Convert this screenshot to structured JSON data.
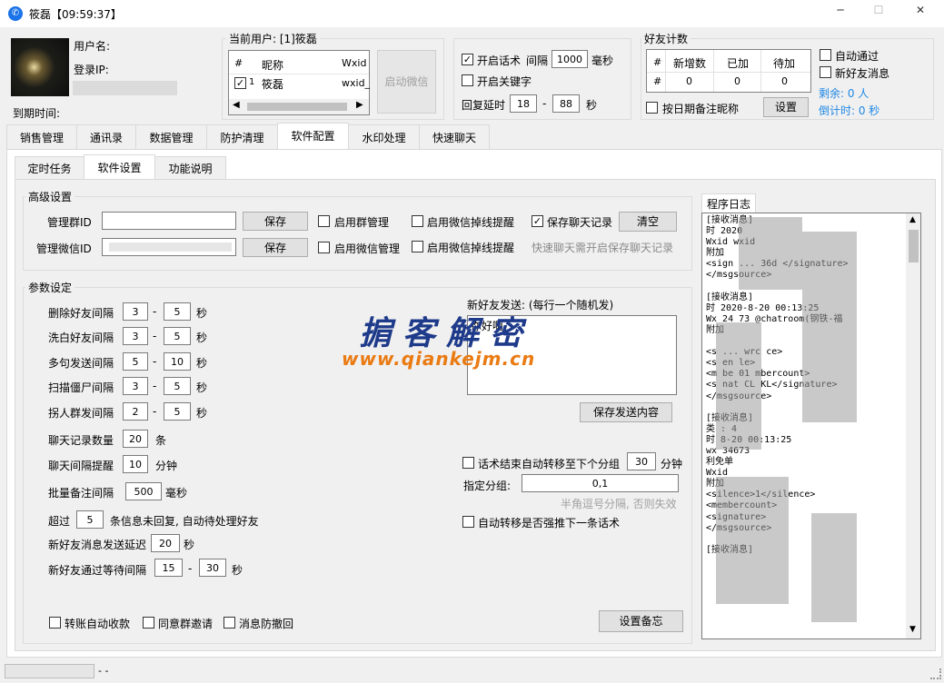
{
  "window": {
    "title": "筱磊【09:59:37】",
    "min": "─",
    "max": "☐",
    "close": "✕"
  },
  "user": {
    "name_label": "用户名:",
    "login_ip_label": "登录IP:",
    "expire_label": "到期时间:"
  },
  "current_user": {
    "label": "当前用户: [1]筱磊",
    "table": {
      "headers": [
        "#",
        "昵称",
        "Wxid"
      ],
      "row": {
        "num": "1",
        "nick": "筱磊",
        "wxid": "wxid_"
      }
    },
    "start_btn": "启动微信"
  },
  "talk": {
    "enable_label": "开启话术",
    "interval_label": "间隔",
    "interval": "1000",
    "ms_unit": "毫秒",
    "keyword_label": "开启关键字",
    "delay_label": "回复延时",
    "delay_min": "18",
    "delay_max": "88",
    "sec_unit": "秒",
    "dash": "-"
  },
  "friend_count": {
    "title": "好友计数",
    "headers": [
      "#",
      "新增数",
      "已加",
      "待加"
    ],
    "row": [
      "#",
      "0",
      "0",
      "0"
    ],
    "remark_label": "按日期备注昵称",
    "setup_btn": "设置",
    "auto_pass": "自动通过",
    "new_friend_msg": "新好友消息",
    "remaining": "剩余: 0 人",
    "countdown": "倒计时: 0 秒"
  },
  "main_tabs": [
    "销售管理",
    "通讯录",
    "数据管理",
    "防护清理",
    "软件配置",
    "水印处理",
    "快速聊天"
  ],
  "sub_tabs": [
    "定时任务",
    "软件设置",
    "功能说明"
  ],
  "advanced": {
    "title": "高级设置",
    "admin_group_label": "管理群ID",
    "admin_wx_label": "管理微信ID",
    "save": "保存",
    "group_mgmt": "启用群管理",
    "offline1": "启用微信掉线提醒",
    "save_chat": "保存聊天记录",
    "clear_btn": "清空",
    "wx_mgmt": "启用微信管理",
    "offline2": "启用微信掉线提醒",
    "hint": "快速聊天需开启保存聊天记录"
  },
  "params": {
    "title": "参数设定",
    "rows": [
      {
        "label": "删除好友间隔",
        "a": "3",
        "b": "5",
        "unit": "秒"
      },
      {
        "label": "洗白好友间隔",
        "a": "3",
        "b": "5",
        "unit": "秒"
      },
      {
        "label": "多句发送间隔",
        "a": "5",
        "b": "10",
        "unit": "秒"
      },
      {
        "label": "扫描僵尸间隔",
        "a": "3",
        "b": "5",
        "unit": "秒"
      },
      {
        "label": "拐人群发间隔",
        "a": "2",
        "b": "5",
        "unit": "秒"
      }
    ],
    "chat_count": {
      "label": "聊天记录数量",
      "value": "20",
      "unit": "条"
    },
    "chat_interval": {
      "label": "聊天间隔提醒",
      "value": "10",
      "unit": "分钟"
    },
    "batch_remark": {
      "label": "批量备注间隔",
      "value": "500",
      "unit": "毫秒"
    },
    "exceed": {
      "prefix": "超过",
      "value": "5",
      "suffix": "条信息未回复, 自动待处理好友"
    },
    "new_delay": {
      "label": "新好友消息发送延迟",
      "value": "20",
      "unit": "秒"
    },
    "new_wait": {
      "label": "新好友通过等待间隔",
      "a": "15",
      "b": "30",
      "unit": "秒"
    },
    "new_send_label": "新好友发送: (每行一个随机发)",
    "new_send_text": "你好啊",
    "save_send_btn": "保存发送内容",
    "auto_move": "话术结束自动转移至下个分组",
    "auto_move_value": "30",
    "minute": "分钟",
    "group_label": "指定分组:",
    "group_value": "0,1",
    "group_hint": "半角逗号分隔, 否则失效",
    "force_next": "自动转移是否强推下一条话术",
    "transfer": "转账自动收款",
    "agree_group": "同意群邀请",
    "anti_recall": "消息防撤回",
    "backup_btn": "设置备忘"
  },
  "log": {
    "title": "程序日志",
    "lines": [
      "[接收消息]",
      "时 2020",
      "Wxid wxid",
      "附加",
      "<sign ... 36d </signature>",
      "</msgsource>",
      "",
      "[接收消息]",
      "时 2020-8-20 00:13:25",
      "Wx 24 73 @chatroom(钢铁-福",
      "附加",
      "",
      "<s ... wrc ce>",
      "<s en le>",
      "<m be 01 mbercount>",
      "<s nat CL KL</signature>",
      "</msgsource>",
      "",
      "[接收消息]",
      "类 : 4",
      "时 8-20 00:13:25",
      "wx 34673",
      "利免单",
      "Wxid",
      "附加",
      "<silence>1</silence>",
      "<membercount>",
      "<signature>",
      "</msgsource>",
      "",
      "[接收消息]"
    ]
  },
  "watermark": {
    "line1": "掮客解密",
    "line2": "www.qiankejm.cn"
  },
  "status": {
    "text": "- -"
  }
}
